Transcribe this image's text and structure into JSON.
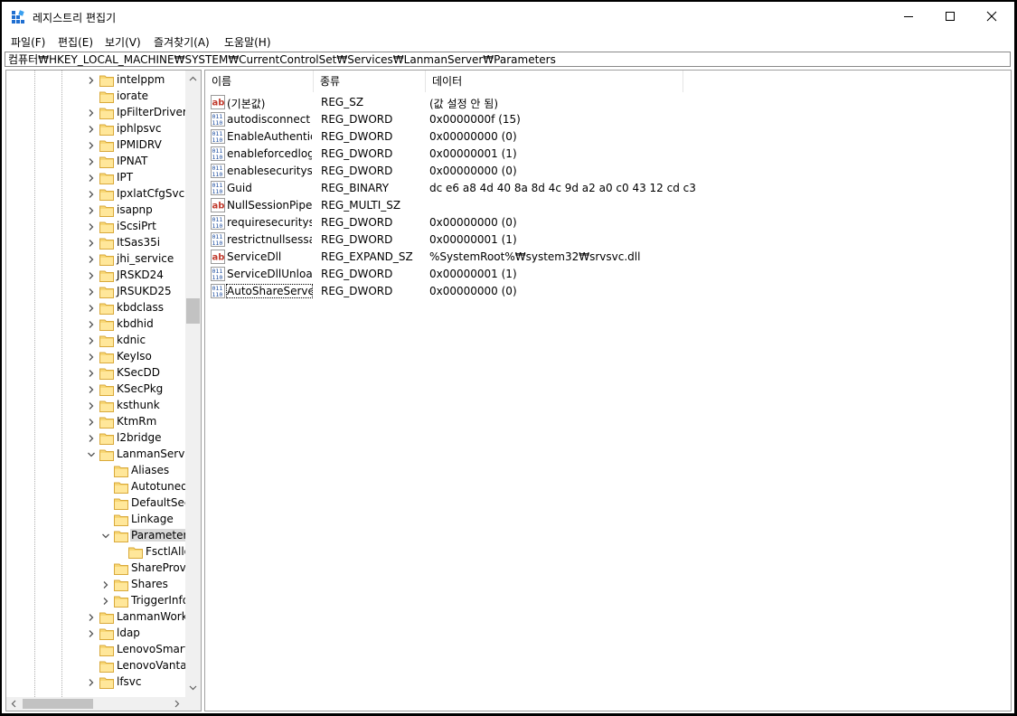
{
  "title": "레지스트리 편집기",
  "menu": [
    "파일(F)",
    "편집(E)",
    "보기(V)",
    "즐겨찾기(A)",
    "도움말(H)"
  ],
  "address": "컴퓨터₩HKEY_LOCAL_MACHINE₩SYSTEM₩CurrentControlSet₩Services₩LanmanServer₩Parameters",
  "columns": {
    "name": "이름",
    "type": "종류",
    "data": "데이터"
  },
  "tree": [
    {
      "label": "intelppm",
      "expander": "collapsed"
    },
    {
      "label": "iorate",
      "expander": "none"
    },
    {
      "label": "IpFilterDriver",
      "expander": "collapsed"
    },
    {
      "label": "iphlpsvc",
      "expander": "collapsed"
    },
    {
      "label": "IPMIDRV",
      "expander": "collapsed"
    },
    {
      "label": "IPNAT",
      "expander": "collapsed"
    },
    {
      "label": "IPT",
      "expander": "collapsed"
    },
    {
      "label": "IpxlatCfgSvc",
      "expander": "collapsed"
    },
    {
      "label": "isapnp",
      "expander": "collapsed"
    },
    {
      "label": "iScsiPrt",
      "expander": "collapsed"
    },
    {
      "label": "ItSas35i",
      "expander": "collapsed"
    },
    {
      "label": "jhi_service",
      "expander": "collapsed"
    },
    {
      "label": "JRSKD24",
      "expander": "collapsed"
    },
    {
      "label": "JRSUKD25",
      "expander": "collapsed"
    },
    {
      "label": "kbdclass",
      "expander": "collapsed"
    },
    {
      "label": "kbdhid",
      "expander": "collapsed"
    },
    {
      "label": "kdnic",
      "expander": "collapsed"
    },
    {
      "label": "KeyIso",
      "expander": "collapsed"
    },
    {
      "label": "KSecDD",
      "expander": "collapsed"
    },
    {
      "label": "KSecPkg",
      "expander": "collapsed"
    },
    {
      "label": "ksthunk",
      "expander": "collapsed"
    },
    {
      "label": "KtmRm",
      "expander": "collapsed"
    },
    {
      "label": "l2bridge",
      "expander": "collapsed"
    },
    {
      "label": "LanmanServer",
      "expander": "expanded"
    },
    {
      "label": "Aliases",
      "level": 1,
      "expander": "none"
    },
    {
      "label": "AutotunedParameters",
      "level": 1,
      "expander": "none"
    },
    {
      "label": "DefaultSecurity",
      "level": 1,
      "expander": "none"
    },
    {
      "label": "Linkage",
      "level": 1,
      "expander": "none"
    },
    {
      "label": "Parameters",
      "level": 1,
      "expander": "expanded",
      "selected": true
    },
    {
      "label": "FsctlAllowlist",
      "level": 2,
      "expander": "none"
    },
    {
      "label": "ShareProviders",
      "level": 1,
      "expander": "none"
    },
    {
      "label": "Shares",
      "level": 1,
      "expander": "collapsed"
    },
    {
      "label": "TriggerInfo",
      "level": 1,
      "expander": "collapsed"
    },
    {
      "label": "LanmanWorkstation",
      "expander": "collapsed"
    },
    {
      "label": "ldap",
      "expander": "collapsed"
    },
    {
      "label": "LenovoSmartStandby",
      "expander": "none"
    },
    {
      "label": "LenovoVantageService",
      "expander": "none"
    },
    {
      "label": "lfsvc",
      "expander": "collapsed"
    }
  ],
  "values": [
    {
      "icon": "string",
      "name": "(기본값)",
      "type": "REG_SZ",
      "data": "(값 설정 안 됨)"
    },
    {
      "icon": "binary",
      "name": "autodisconnect",
      "type": "REG_DWORD",
      "data": "0x0000000f (15)"
    },
    {
      "icon": "binary",
      "name": "EnableAuthentic...",
      "type": "REG_DWORD",
      "data": "0x00000000 (0)"
    },
    {
      "icon": "binary",
      "name": "enableforcedlog...",
      "type": "REG_DWORD",
      "data": "0x00000001 (1)"
    },
    {
      "icon": "binary",
      "name": "enablesecuritysi...",
      "type": "REG_DWORD",
      "data": "0x00000000 (0)"
    },
    {
      "icon": "binary",
      "name": "Guid",
      "type": "REG_BINARY",
      "data": "dc e6 a8 4d 40 8a 8d 4c 9d a2 a0 c0 43 12 cd c3"
    },
    {
      "icon": "string",
      "name": "NullSessionPipes",
      "type": "REG_MULTI_SZ",
      "data": ""
    },
    {
      "icon": "binary",
      "name": "requiresecuritysi...",
      "type": "REG_DWORD",
      "data": "0x00000000 (0)"
    },
    {
      "icon": "binary",
      "name": "restrictnullsessa...",
      "type": "REG_DWORD",
      "data": "0x00000001 (1)"
    },
    {
      "icon": "string",
      "name": "ServiceDll",
      "type": "REG_EXPAND_SZ",
      "data": "%SystemRoot%₩system32₩srvsvc.dll"
    },
    {
      "icon": "binary",
      "name": "ServiceDllUnloa...",
      "type": "REG_DWORD",
      "data": "0x00000001 (1)"
    },
    {
      "icon": "binary",
      "name": "AutoShareServer",
      "type": "REG_DWORD",
      "data": "0x00000000 (0)",
      "focused": true
    }
  ]
}
